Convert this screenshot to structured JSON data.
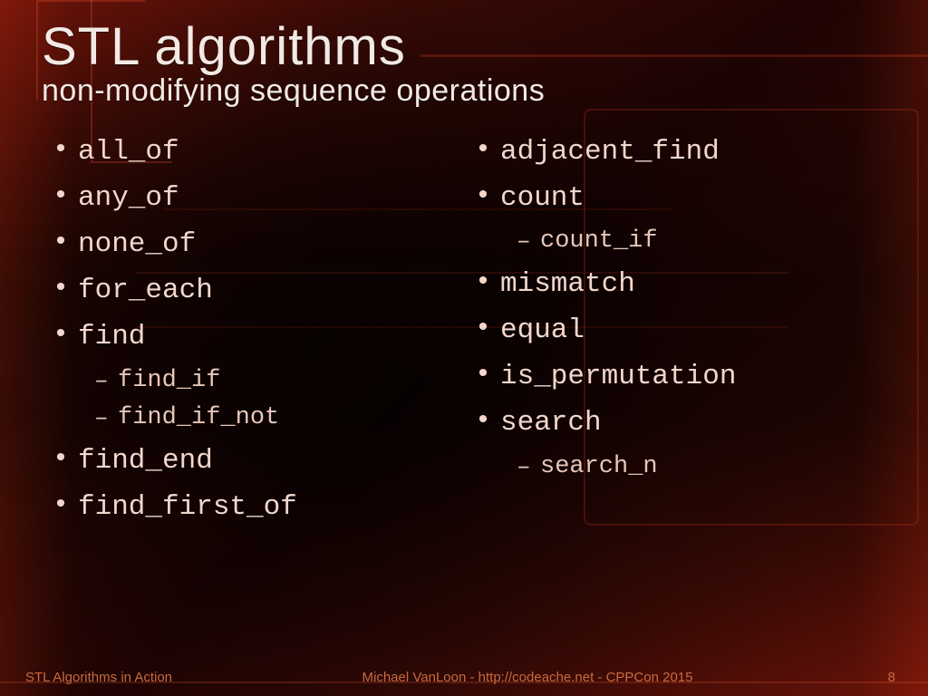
{
  "title": "STL algorithms",
  "subtitle": "non-modifying sequence operations",
  "left_col": [
    {
      "text": "all_of"
    },
    {
      "text": "any_of"
    },
    {
      "text": "none_of"
    },
    {
      "text": "for_each"
    },
    {
      "text": "find",
      "sub": [
        "find_if",
        "find_if_not"
      ]
    },
    {
      "text": "find_end"
    },
    {
      "text": "find_first_of"
    }
  ],
  "right_col": [
    {
      "text": "adjacent_find"
    },
    {
      "text": "count",
      "sub": [
        "count_if"
      ]
    },
    {
      "text": "mismatch"
    },
    {
      "text": "equal"
    },
    {
      "text": "is_permutation"
    },
    {
      "text": "search",
      "sub": [
        "search_n"
      ]
    }
  ],
  "footer": {
    "left": "STL Algorithms in Action",
    "center": "Michael VanLoon - http://codeache.net - CPPCon 2015",
    "page": "8"
  }
}
